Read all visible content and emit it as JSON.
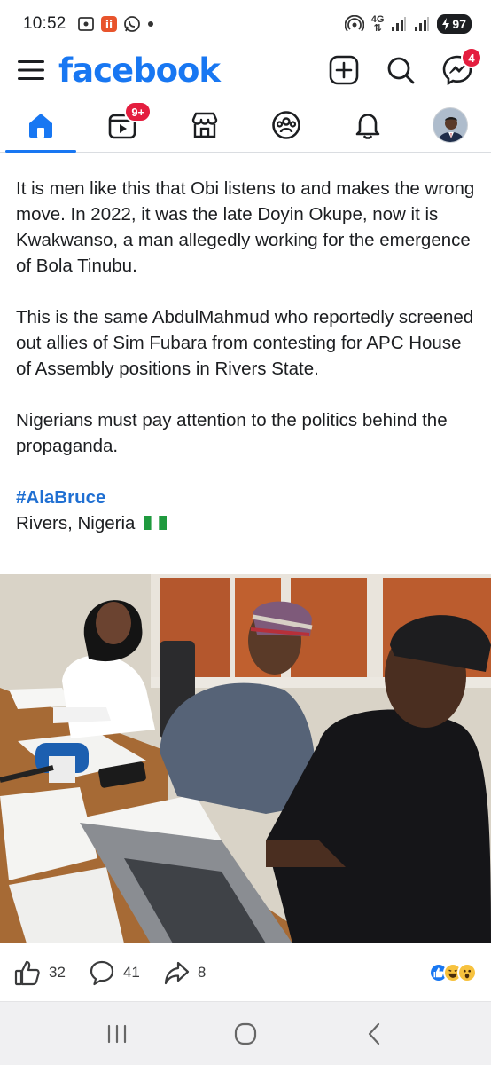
{
  "status_bar": {
    "time": "10:52",
    "network": "4G",
    "battery": "97"
  },
  "header": {
    "logo": "facebook",
    "messenger_badge": "4"
  },
  "tabs": [
    {
      "name": "home",
      "active": true
    },
    {
      "name": "video",
      "badge": "9+"
    },
    {
      "name": "marketplace"
    },
    {
      "name": "groups"
    },
    {
      "name": "notifications"
    },
    {
      "name": "profile"
    }
  ],
  "post": {
    "paragraphs": [
      "It is men like this that Obi listens to and makes the wrong move. In 2022, it was the late Doyin Okupe, now it is Kwakwanso, a man allegedly working for the emergence of Bola Tinubu.",
      "This is the same AbdulMahmud who reportedly screened out allies of Sim Fubara from contesting for APC House of Assembly positions in Rivers State.",
      "Nigerians must pay attention to the politics behind the propaganda."
    ],
    "hashtag": "#AlaBruce",
    "location": "Rivers, Nigeria"
  },
  "reactions": {
    "likes": "32",
    "comments": "41",
    "shares": "8"
  },
  "colors": {
    "brand_blue": "#1877f2",
    "badge_red": "#e41e3f",
    "hashtag_blue": "#1f6fd2"
  }
}
